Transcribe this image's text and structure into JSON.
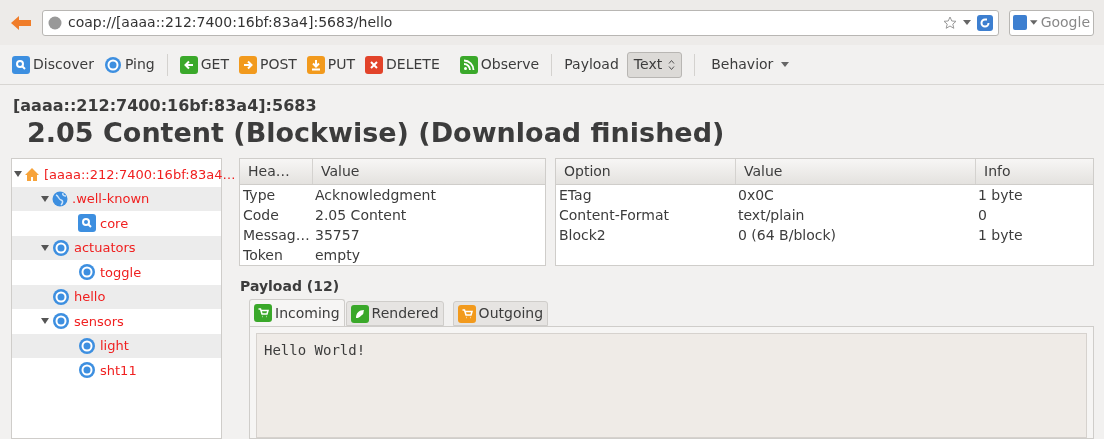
{
  "address_bar": {
    "url": "coap://[aaaa::212:7400:16bf:83a4]:5683/hello",
    "search_placeholder": "Google"
  },
  "toolbar": [
    {
      "kind": "discover",
      "label": "Discover"
    },
    {
      "kind": "ping",
      "label": "Ping"
    },
    {
      "kind": "separator"
    },
    {
      "kind": "get",
      "label": "GET"
    },
    {
      "kind": "post",
      "label": "POST"
    },
    {
      "kind": "put",
      "label": "PUT"
    },
    {
      "kind": "delete",
      "label": "DELETE"
    },
    {
      "kind": "observe",
      "label": "Observe"
    },
    {
      "kind": "separator"
    },
    {
      "kind": "payload",
      "label": "Payload",
      "value": "Text"
    },
    {
      "kind": "separator"
    },
    {
      "kind": "menu",
      "label": "Behavior"
    }
  ],
  "response": {
    "host": "[aaaa::212:7400:16bf:83a4]:5683",
    "status": "2.05 Content (Blockwise) (Download finished)"
  },
  "tree": [
    {
      "label": "[aaaa::212:7400:16bf:83a4…",
      "kind": "host",
      "expanded": true,
      "children": [
        {
          "label": ".well-known",
          "kind": "folder",
          "expanded": true,
          "children": [
            {
              "label": "core",
              "kind": "discovery"
            }
          ]
        },
        {
          "label": "actuators",
          "kind": "resource",
          "expanded": true,
          "children": [
            {
              "label": "toggle",
              "kind": "resource"
            }
          ]
        },
        {
          "label": "hello",
          "kind": "resource"
        },
        {
          "label": "sensors",
          "kind": "resource",
          "expanded": true,
          "children": [
            {
              "label": "light",
              "kind": "resource"
            },
            {
              "label": "sht11",
              "kind": "resource"
            }
          ]
        }
      ]
    }
  ],
  "headers_table": {
    "columns": [
      "Hea…",
      "Value"
    ],
    "rows": [
      [
        "Type",
        "Acknowledgment"
      ],
      [
        "Code",
        "2.05 Content"
      ],
      [
        "Messag…",
        "35757"
      ],
      [
        "Token",
        "empty"
      ]
    ]
  },
  "options_table": {
    "columns": [
      "Option",
      "Value",
      "Info"
    ],
    "rows": [
      [
        "ETag",
        "0x0C",
        "1 byte"
      ],
      [
        "Content-Format",
        "text/plain",
        "0"
      ],
      [
        "Block2",
        "0 (64 B/block)",
        "1 byte"
      ]
    ]
  },
  "payload": {
    "title": "Payload (12)",
    "tabs": [
      {
        "label": "Incoming",
        "kind": "incoming",
        "selected": true
      },
      {
        "label": "Rendered",
        "kind": "rendered",
        "selected": false
      },
      {
        "label": "Outgoing",
        "kind": "outgoing",
        "selected": false
      }
    ],
    "content": "Hello World!"
  }
}
